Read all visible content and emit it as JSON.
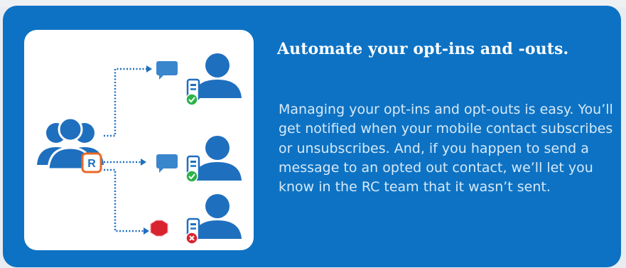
{
  "feature": {
    "title": "Automate your opt-ins and -outs.",
    "description": "Managing your opt-ins and opt-outs is easy. You’ll get notified when your mobile contact subscribes or unsubscribes. And, if you happen to send a message to an opted out contact, we’ll let you know in the RC team that it wasn’t sent."
  },
  "illustration": {
    "logo_letter": "R",
    "contacts": [
      {
        "status": "subscribed",
        "icon": "check-icon"
      },
      {
        "status": "subscribed",
        "icon": "check-icon"
      },
      {
        "status": "opted-out",
        "icon": "x-icon"
      }
    ],
    "colors": {
      "card_bg": "#0d72c3",
      "people": "#1f6fbf",
      "accent_orange": "#e86a28",
      "check_green": "#2db34a",
      "error_red": "#d9232e",
      "message_bubble": "#3a86cc"
    }
  }
}
